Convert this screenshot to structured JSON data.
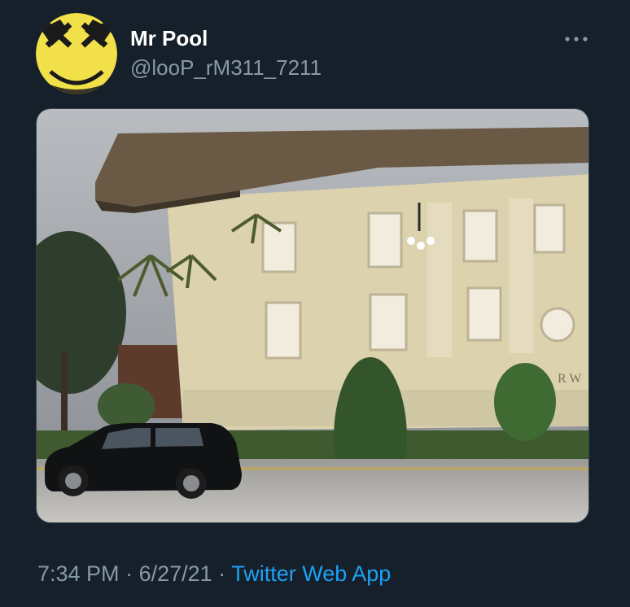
{
  "tweet": {
    "author": {
      "display_name": "Mr Pool",
      "handle": "@looP_rM311_7211",
      "avatar_icon": "deadpool-smiley-avatar"
    },
    "more_icon": "more-horizontal-icon",
    "media": {
      "kind": "photo",
      "subject": "upside-down building with parked black SUV",
      "sign_letters": "R W"
    },
    "time": "7:34 PM",
    "separator": "·",
    "date": "6/27/21",
    "source": "Twitter Web App"
  },
  "colors": {
    "background": "#15202b",
    "secondary_text": "#8899a6",
    "link": "#1da1f2",
    "avatar_yellow": "#f1e049"
  }
}
